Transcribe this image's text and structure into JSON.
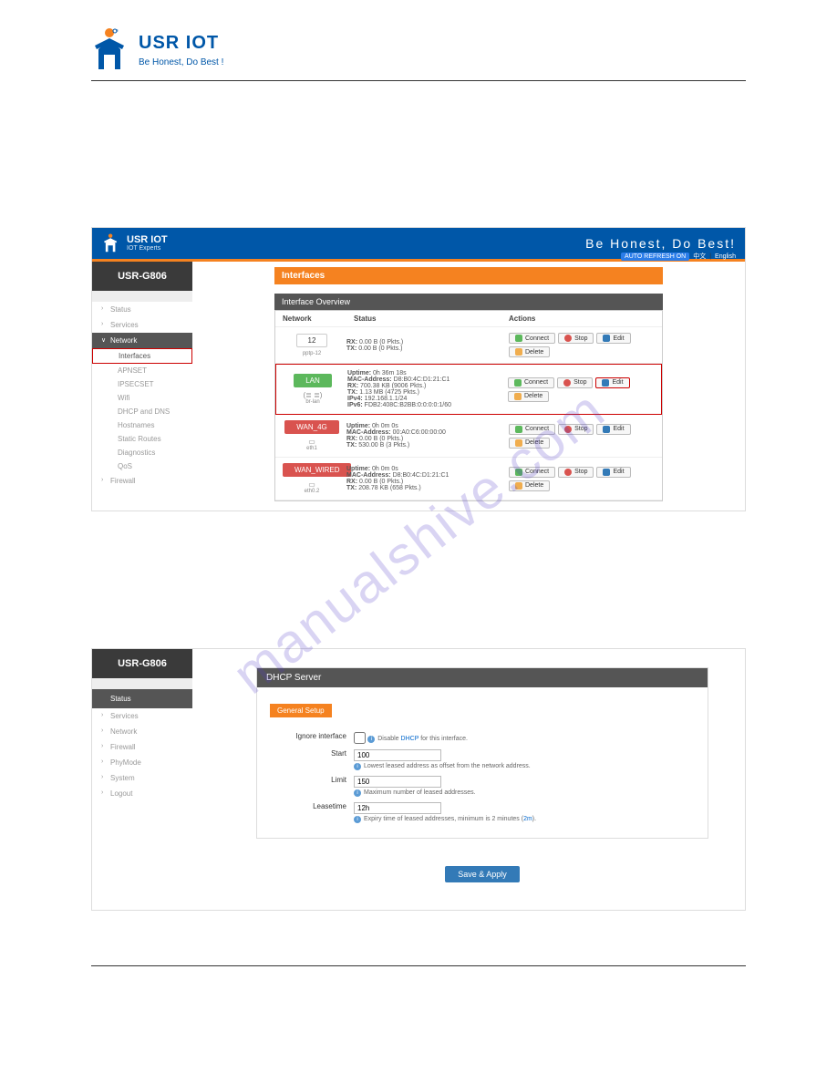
{
  "logo": {
    "title": "USR IOT",
    "slogan": "Be Honest, Do Best !"
  },
  "shot1": {
    "brand": "USR IOT",
    "brandSub": "IOT Experts",
    "tagline": "Be Honest, Do Best!",
    "autoRefresh": "AUTO REFRESH ON",
    "langs": [
      "中文",
      "English"
    ],
    "device": "USR-G806",
    "sidebar": {
      "items": [
        "Status",
        "Services",
        "Network"
      ],
      "sub": [
        "Interfaces",
        "APNSET",
        "IPSECSET",
        "Wifi",
        "DHCP and DNS",
        "Hostnames",
        "Static Routes",
        "Diagnostics",
        "QoS"
      ],
      "after": [
        "Firewall"
      ]
    },
    "pageTitle": "Interfaces",
    "overview": "Interface Overview",
    "cols": {
      "net": "Network",
      "status": "Status",
      "actions": "Actions"
    },
    "actions": {
      "connect": "Connect",
      "stop": "Stop",
      "edit": "Edit",
      "delete": "Delete"
    },
    "rows": [
      {
        "name": "12",
        "dev": "pptp-12",
        "cls": "",
        "hl": false,
        "editHl": false,
        "status": [
          {
            "k": "RX",
            "v": "0.00 B (0 Pkts.)"
          },
          {
            "k": "TX",
            "v": "0.00 B (0 Pkts.)"
          }
        ]
      },
      {
        "name": "LAN",
        "dev": "br-lan",
        "cls": "green",
        "hl": true,
        "editHl": true,
        "icon": "(≣ ≣)",
        "status": [
          {
            "k": "Uptime",
            "v": "0h 36m 18s"
          },
          {
            "k": "MAC-Address",
            "v": "D8:B0:4C:D1:21:C1"
          },
          {
            "k": "RX",
            "v": "700.38 KB (9006 Pkts.)"
          },
          {
            "k": "TX",
            "v": "1.13 MB (4725 Pkts.)"
          },
          {
            "k": "IPv4",
            "v": "192.168.1.1/24"
          },
          {
            "k": "IPv6",
            "v": "FDB2:408C:B2BB:0:0:0:0:1/60"
          }
        ]
      },
      {
        "name": "WAN_4G",
        "dev": "eth1",
        "cls": "red",
        "hl": false,
        "editHl": false,
        "icon": "▭",
        "status": [
          {
            "k": "Uptime",
            "v": "0h 0m 0s"
          },
          {
            "k": "MAC-Address",
            "v": "00:A0:C6:00:00:00"
          },
          {
            "k": "RX",
            "v": "0.00 B (0 Pkts.)"
          },
          {
            "k": "TX",
            "v": "530.00 B (3 Pkts.)"
          }
        ]
      },
      {
        "name": "WAN_WIRED",
        "dev": "eth0.2",
        "cls": "red",
        "hl": false,
        "editHl": false,
        "icon": "▭",
        "status": [
          {
            "k": "Uptime",
            "v": "0h 0m 0s"
          },
          {
            "k": "MAC-Address",
            "v": "D8:B0:4C:D1:21:C1"
          },
          {
            "k": "RX",
            "v": "0.00 B (0 Pkts.)"
          },
          {
            "k": "TX",
            "v": "208.78 KB (658 Pkts.)"
          }
        ]
      }
    ]
  },
  "shot2": {
    "device": "USR-G806",
    "sidebar": {
      "active": "Status",
      "items": [
        "Services",
        "Network",
        "Firewall",
        "PhyMode",
        "System",
        "Logout"
      ]
    },
    "title": "DHCP Server",
    "tab": "General Setup",
    "fields": {
      "ignore": {
        "label": "Ignore interface",
        "hint": "Disable DHCP for this interface.",
        "link": "DHCP"
      },
      "start": {
        "label": "Start",
        "value": "100",
        "hint": "Lowest leased address as offset from the network address."
      },
      "limit": {
        "label": "Limit",
        "value": "150",
        "hint": "Maximum number of leased addresses."
      },
      "lease": {
        "label": "Leasetime",
        "value": "12h",
        "hint1": "Expiry time of leased addresses, minimum is 2 minutes (",
        "hint2": "2m",
        "hint3": ")."
      }
    },
    "save": "Save & Apply"
  },
  "watermark": "manualshive.com"
}
